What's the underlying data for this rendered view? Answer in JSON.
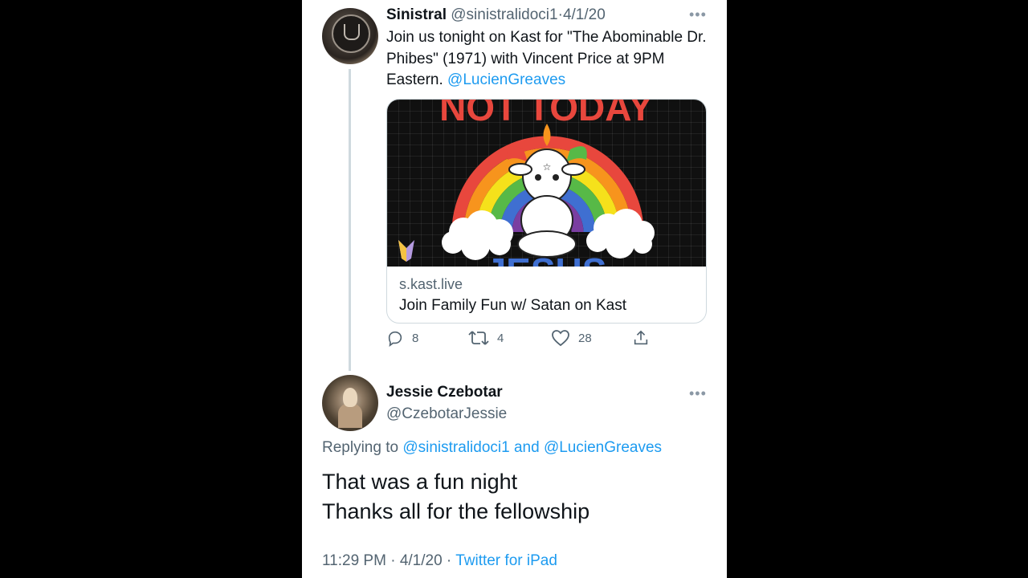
{
  "tweet1": {
    "name": "Sinistral",
    "handle": "@sinistralidoci1",
    "separator": "·",
    "date": "4/1/20",
    "more": "•••",
    "text": "Join us tonight on Kast for \"The Abominable Dr. Phibes\" (1971) with Vincent Price at 9PM Eastern. ",
    "mention": "@LucienGreaves",
    "card": {
      "image_top_text": "NOT TODAY",
      "image_bottom_text": "JESUS",
      "domain": "s.kast.live",
      "title": "Join Family Fun w/ Satan on Kast"
    },
    "actions": {
      "reply_icon": "reply-icon",
      "reply_count": "8",
      "retweet_icon": "retweet-icon",
      "retweet_count": "4",
      "like_icon": "heart-icon",
      "like_count": "28",
      "share_icon": "share-icon"
    }
  },
  "tweet2": {
    "name": "Jessie Czebotar",
    "handle": "@CzebotarJessie",
    "more": "•••",
    "replying_prefix": "Replying to ",
    "replying_user1": "@sinistralidoci1",
    "replying_and": " and ",
    "replying_user2": "@LucienGreaves",
    "line1": "That was a fun night",
    "line2": "Thanks all for the fellowship",
    "time": "11:29 PM",
    "date": "4/1/20",
    "separator": " · ",
    "source": "Twitter for iPad"
  },
  "colors": {
    "link": "#1d9bf0",
    "secondary_text": "#536471",
    "primary_text": "#0f1419"
  }
}
